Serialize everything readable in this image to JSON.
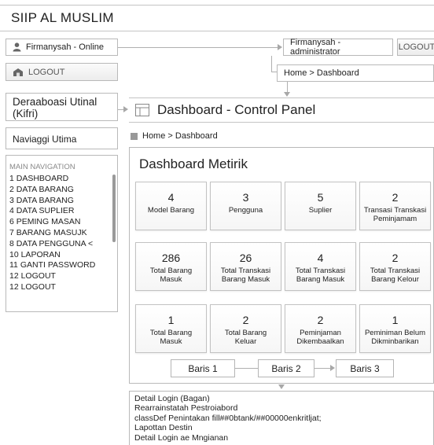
{
  "app_title": "SIIP AL MUSLIM",
  "user_status": "Firmanysah - Online",
  "user_role": "Firmanysah - administrator",
  "logout_top": "LOGOUT",
  "logout_side": "LOGOUT",
  "breadcrumb_top": "Home > Dashboard",
  "org_name": "Deraaboasi Utinal (Kifri)",
  "panel_title": "Dashboard - Control Panel",
  "nav_title": "Naviaggi Utima",
  "breadcrumb_main": "Home > Dashboard",
  "nav_section": "MAIN NAVIGATION",
  "nav_items": [
    "1  DASHBOARD",
    "2  DATA BARANG",
    "3  DATA BARANG",
    "4  DATA SUPLIER",
    "6  PEMING MASAN",
    "7  BARANG MASUJK",
    "8  DATA PENGGUNA <",
    "10 LAPORAN",
    "11 GANTI PASSWORD",
    "12 LOGOUT",
    "12 LOGOUT"
  ],
  "metrics_title": "Dashboard Metirik",
  "metrics": [
    {
      "value": "4",
      "label": "Model Barang"
    },
    {
      "value": "3",
      "label": "Pengguna"
    },
    {
      "value": "5",
      "label": "Suplier"
    },
    {
      "value": "2",
      "label": "Transasi Transkasi Peminjamam"
    },
    {
      "value": "286",
      "label": "Total Barang Masuk"
    },
    {
      "value": "26",
      "label": "Total Transkasi Barang Masuk"
    },
    {
      "value": "4",
      "label": "Total Transkasi Barang Masuk"
    },
    {
      "value": "2",
      "label": "Total Transkasi Barang Kelour"
    },
    {
      "value": "1",
      "label": "Total Barang Masuk"
    },
    {
      "value": "2",
      "label": "Total Barang Keluar"
    },
    {
      "value": "2",
      "label": "Peminjaman Dikembaalkan"
    },
    {
      "value": "1",
      "label": "Peminiman Belum Dikminbarikan"
    }
  ],
  "baris": [
    "Baris 1",
    "Baris 2",
    "Baris 3"
  ],
  "detail": {
    "title": "Detail Login",
    "title_suffix": "(Bagan)",
    "lines": [
      "Rearrainstatah Pestroiabord",
      "classDef Penintakan fill##0btank/##00000enkritljat;",
      "Lapottan Destin",
      "Detail Login ae Mngianan"
    ]
  },
  "icons": {
    "user": "user-icon",
    "logout": "logout-icon",
    "panel": "panel-grid-icon",
    "breadcrumb": "home-square-icon"
  }
}
